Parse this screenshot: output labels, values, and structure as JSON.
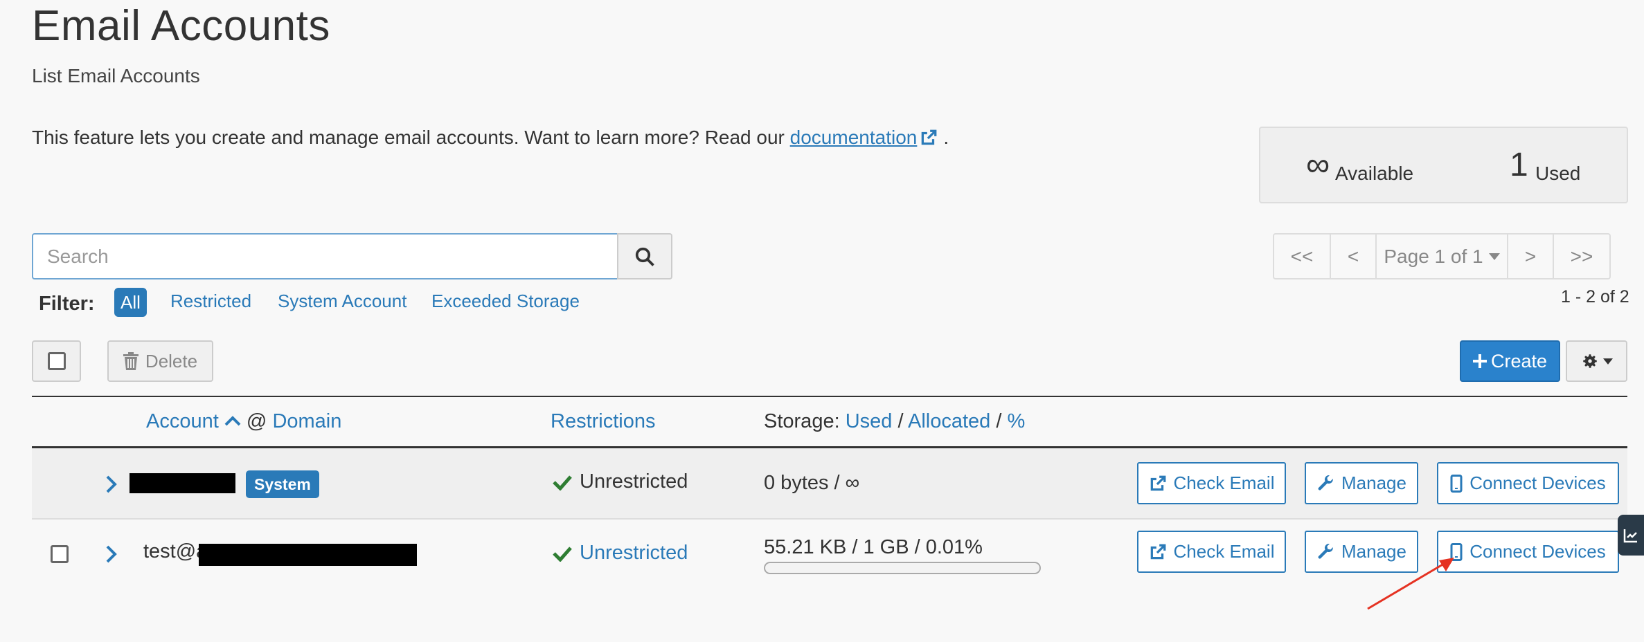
{
  "header": {
    "title": "Email Accounts",
    "subtitle": "List Email Accounts",
    "intro_text": "This feature lets you create and manage email accounts. Want to learn more? Read our ",
    "intro_link": "documentation",
    "intro_end": "."
  },
  "stats": {
    "available_value": "∞",
    "available_label": "Available",
    "used_value": "1",
    "used_label": "Used"
  },
  "search": {
    "placeholder": "Search"
  },
  "pagination": {
    "first": "<<",
    "prev": "<",
    "page_label": "Page 1 of 1",
    "next": ">",
    "last": ">>",
    "count": "1 - 2 of 2"
  },
  "filter": {
    "label": "Filter:",
    "options": [
      "All",
      "Restricted",
      "System Account",
      "Exceeded Storage"
    ],
    "selected": "All"
  },
  "toolbar": {
    "delete_label": "Delete",
    "create_label": "Create"
  },
  "table": {
    "headers": {
      "account": "Account",
      "at": "@",
      "domain": "Domain",
      "restrictions": "Restrictions",
      "storage_prefix": "Storage:",
      "used": "Used",
      "allocated": "Allocated",
      "percent": "%",
      "sep": "/"
    },
    "rows": [
      {
        "badge": "System",
        "restriction": "Unrestricted",
        "storage": "0 bytes / ∞",
        "actions": [
          "Check Email",
          "Manage",
          "Connect Devices"
        ]
      },
      {
        "account_prefix": "test@a",
        "restriction": "Unrestricted",
        "storage": "55.21 KB / 1 GB / 0.01%",
        "usage_percent": 0.01,
        "actions": [
          "Check Email",
          "Manage",
          "Connect Devices"
        ]
      }
    ]
  },
  "colors": {
    "accent": "#2a7ab8",
    "success": "#2e7d32",
    "annotation_arrow": "#e53222"
  }
}
